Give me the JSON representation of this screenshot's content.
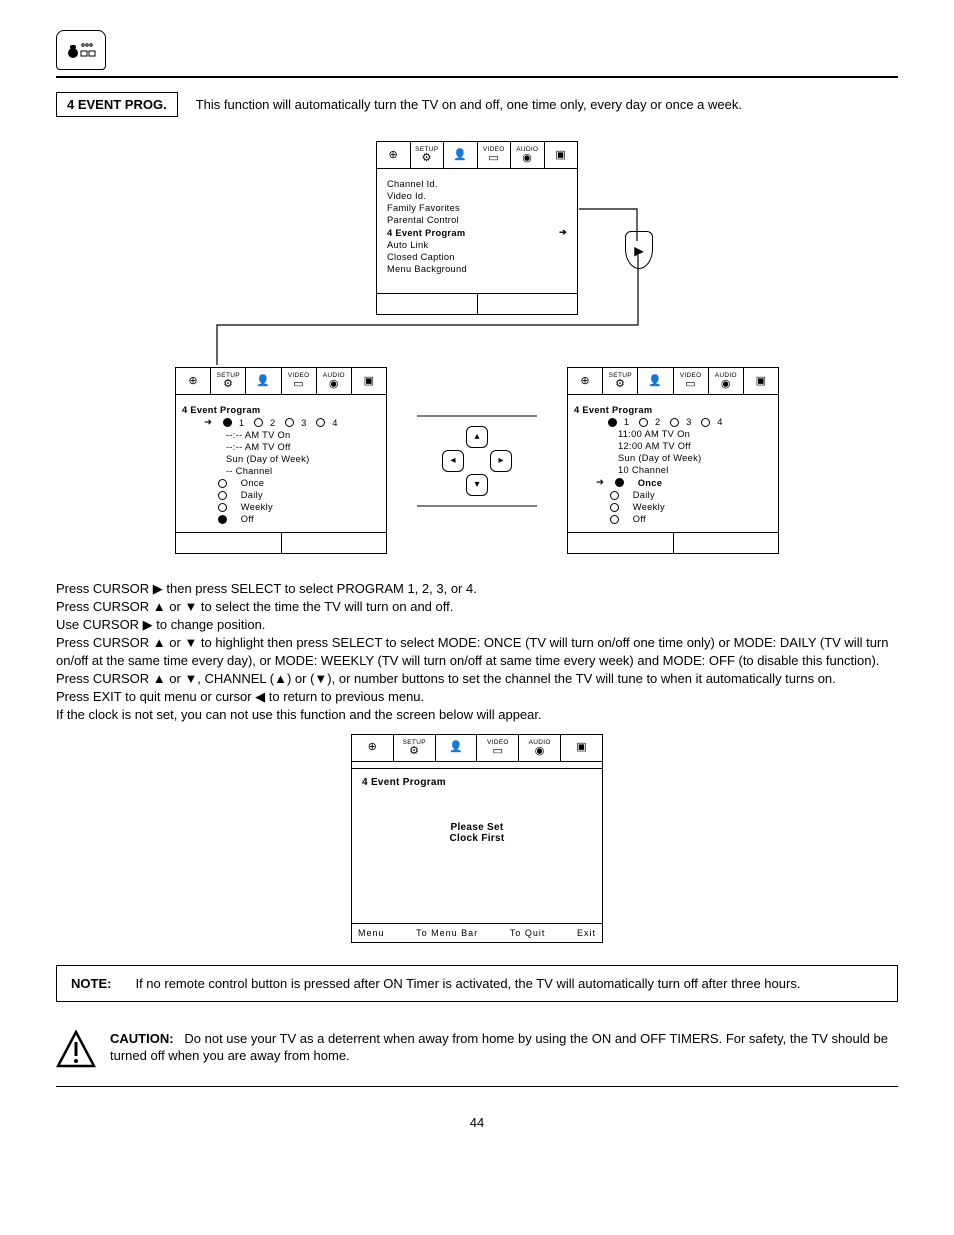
{
  "header": {
    "section_label": "4 EVENT PROG.",
    "section_desc": "This function will automatically turn the TV on and off, one time only, every day or once a week."
  },
  "osd_tabs": {
    "t1": "",
    "t2": "SETUP",
    "t3": "",
    "t4": "VIDEO",
    "t5": "AUDIO",
    "t6": ""
  },
  "osd_main": {
    "l1": "Channel Id.",
    "l2": "Video Id.",
    "l3": "Family Favorites",
    "l4": "Parental Control",
    "l5": "4 Event Program",
    "l6": "Auto Link",
    "l7": "Closed Caption",
    "l8": "Menu Background"
  },
  "osd_left": {
    "title": "4 Event Program",
    "nums": "1      2      3      4",
    "r_on": "--:-- AM TV On",
    "r_off": "--:-- AM TV Off",
    "r_day": "Sun (Day of Week)",
    "r_ch": "-- Channel",
    "m_once": "Once",
    "m_daily": "Daily",
    "m_weekly": "Weekly",
    "m_off": "Off"
  },
  "osd_right": {
    "title": "4 Event Program",
    "nums": "1      2      3      4",
    "r_on": "11:00 AM TV On",
    "r_off": "12:00 AM TV Off",
    "r_day": "Sun  (Day of Week)",
    "r_ch": "10 Channel",
    "m_once": "Once",
    "m_daily": "Daily",
    "m_weekly": "Weekly",
    "m_off": "Off"
  },
  "instructions": {
    "p1": "Press CURSOR ▶ then press SELECT to select PROGRAM 1, 2, 3, or 4.",
    "p2": "Press CURSOR ▲ or ▼ to select the time the TV will turn on and off.",
    "p3": "Use CURSOR ▶ to change position.",
    "p4": "Press CURSOR ▲ or ▼ to highlight then press SELECT to select MODE: ONCE (TV will turn on/off one time only) or MODE: DAILY (TV will turn on/off at the same time every day), or MODE: WEEKLY (TV will turn on/off at same time every week) and MODE: OFF (to disable this function).",
    "p5": "Press CURSOR ▲ or ▼, CHANNEL (▲) or (▼), or number buttons to set the channel the TV will tune to when it automatically turns on.",
    "p6": "Press EXIT to quit menu or cursor ◀ to return to previous menu.",
    "p7": "If the clock is not set, you can not use this function and the screen below will appear."
  },
  "osd_clock": {
    "title": "4 Event Program",
    "msg1": "Please Set",
    "msg2": "Clock First",
    "status_menu": "Menu",
    "status_to_bar": "To Menu Bar",
    "status_quit": "To Quit",
    "status_exit": "Exit"
  },
  "note": {
    "label": "NOTE:",
    "text": "If no remote control button is pressed after ON Timer is activated, the TV will automatically turn off after three hours."
  },
  "caution": {
    "label": "CAUTION:",
    "text": "Do not use your TV as a deterrent when away from home by using the ON and OFF TIMERS.  For safety, the TV should be turned off when you are away from home."
  },
  "page_number": "44"
}
